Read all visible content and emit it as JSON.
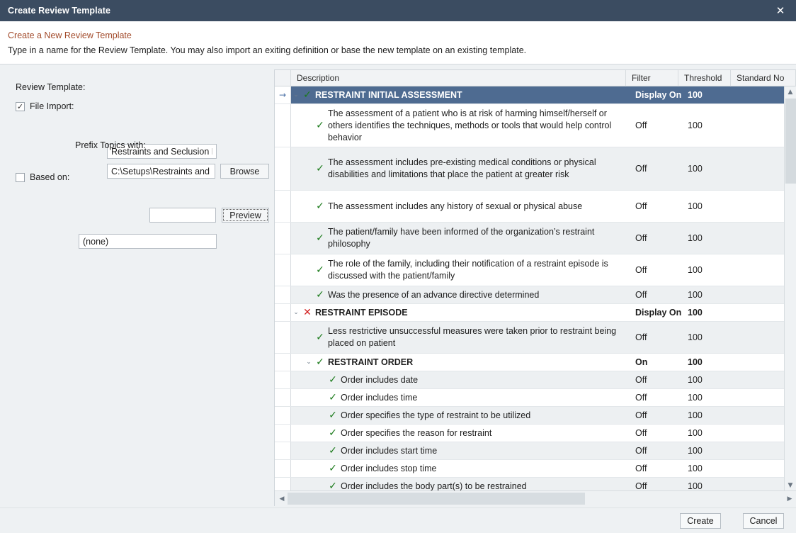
{
  "window": {
    "title": "Create Review Template",
    "close_icon": "close-icon"
  },
  "intro": {
    "heading": "Create a New Review Template",
    "subtext": "Type in a name for the Review Template. You may also import an exiting definition or base the new template on an existing template."
  },
  "form": {
    "review_template_label": "Review Template:",
    "review_template_value": "Restraints and Seclusion Focus",
    "file_import_label": "File Import:",
    "file_import_checked": "✓",
    "file_import_value": "C:\\Setups\\Restraints and Secl",
    "browse_label": "Browse",
    "prefix_label": "Prefix Topics with:",
    "prefix_value": "",
    "preview_label": "Preview",
    "based_on_label": "Based on:",
    "based_on_checked": "",
    "based_on_value": "(none)"
  },
  "grid": {
    "columns": [
      "Description",
      "Filter",
      "Threshold",
      "Standard No"
    ],
    "row_indicator": "→",
    "chevron_open": "⌄",
    "check_mark": "✓",
    "cross_mark": "✕",
    "rows": [
      {
        "level": 0,
        "group": true,
        "selected": true,
        "alt": false,
        "expander": true,
        "mark": "check",
        "indicator": true,
        "description": "RESTRAINT INITIAL ASSESSMENT",
        "filter": "Display On",
        "threshold": "100"
      },
      {
        "level": 1,
        "group": false,
        "selected": false,
        "alt": false,
        "expander": false,
        "mark": "check",
        "indicator": false,
        "description": "The assessment of a patient who is at risk of harming himself/herself or others identifies the techniques, methods or tools that would help control behavior",
        "filter": "Off",
        "threshold": "100"
      },
      {
        "level": 1,
        "group": false,
        "selected": false,
        "alt": true,
        "expander": false,
        "mark": "check",
        "indicator": false,
        "description": "The assessment includes pre-existing medical conditions or physical disabilities and limitations that place the patient at greater risk",
        "filter": "Off",
        "threshold": "100"
      },
      {
        "level": 1,
        "group": false,
        "selected": false,
        "alt": false,
        "expander": false,
        "mark": "check",
        "indicator": false,
        "description": "The assessment includes any history of sexual or physical abuse",
        "filter": "Off",
        "threshold": "100"
      },
      {
        "level": 1,
        "group": false,
        "selected": false,
        "alt": true,
        "expander": false,
        "mark": "check",
        "indicator": false,
        "description": "The patient/family have been informed of the organization’s restraint philosophy",
        "filter": "Off",
        "threshold": "100"
      },
      {
        "level": 1,
        "group": false,
        "selected": false,
        "alt": false,
        "expander": false,
        "mark": "check",
        "indicator": false,
        "description": "The role of the family, including their notification of a restraint episode is discussed with the patient/family",
        "filter": "Off",
        "threshold": "100"
      },
      {
        "level": 1,
        "group": false,
        "selected": false,
        "alt": true,
        "expander": false,
        "mark": "check",
        "indicator": false,
        "description": "Was the presence of an advance directive determined",
        "filter": "Off",
        "threshold": "100"
      },
      {
        "level": 0,
        "group": true,
        "selected": false,
        "alt": false,
        "expander": true,
        "mark": "cross",
        "indicator": false,
        "description": "RESTRAINT EPISODE",
        "filter": "Display On",
        "threshold": "100"
      },
      {
        "level": 1,
        "group": false,
        "selected": false,
        "alt": true,
        "expander": false,
        "mark": "check",
        "indicator": false,
        "description": "Less restrictive unsuccessful measures were taken prior to restraint being placed on patient",
        "filter": "Off",
        "threshold": "100"
      },
      {
        "level": 1,
        "group": true,
        "selected": false,
        "alt": false,
        "expander": true,
        "mark": "check",
        "indicator": false,
        "description": "RESTRAINT ORDER",
        "filter": "On",
        "threshold": "100"
      },
      {
        "level": 2,
        "group": false,
        "selected": false,
        "alt": true,
        "expander": false,
        "mark": "check",
        "indicator": false,
        "description": "Order includes date",
        "filter": "Off",
        "threshold": "100"
      },
      {
        "level": 2,
        "group": false,
        "selected": false,
        "alt": false,
        "expander": false,
        "mark": "check",
        "indicator": false,
        "description": "Order includes time",
        "filter": "Off",
        "threshold": "100"
      },
      {
        "level": 2,
        "group": false,
        "selected": false,
        "alt": true,
        "expander": false,
        "mark": "check",
        "indicator": false,
        "description": "Order specifies the type of restraint to be utilized",
        "filter": "Off",
        "threshold": "100"
      },
      {
        "level": 2,
        "group": false,
        "selected": false,
        "alt": false,
        "expander": false,
        "mark": "check",
        "indicator": false,
        "description": "Order specifies the reason for restraint",
        "filter": "Off",
        "threshold": "100"
      },
      {
        "level": 2,
        "group": false,
        "selected": false,
        "alt": true,
        "expander": false,
        "mark": "check",
        "indicator": false,
        "description": "Order includes start time",
        "filter": "Off",
        "threshold": "100"
      },
      {
        "level": 2,
        "group": false,
        "selected": false,
        "alt": false,
        "expander": false,
        "mark": "check",
        "indicator": false,
        "description": "Order includes stop time",
        "filter": "Off",
        "threshold": "100"
      },
      {
        "level": 2,
        "group": false,
        "selected": false,
        "alt": true,
        "expander": false,
        "mark": "check",
        "indicator": false,
        "description": "Order includes the body part(s) to be restrained",
        "filter": "Off",
        "threshold": "100"
      }
    ],
    "scroll_up_icon": "▲",
    "scroll_down_icon": "▼",
    "scroll_left_icon": "◀",
    "scroll_right_icon": "▶"
  },
  "footer": {
    "create_label": "Create",
    "cancel_label": "Cancel"
  },
  "colors": {
    "titlebar": "#3b4c61",
    "selected_row": "#4e6b91",
    "heading_accent": "#a24a2a",
    "check_green": "#1a7a1a",
    "cross_red": "#d21f1f",
    "panel_bg": "#eef1f3"
  }
}
